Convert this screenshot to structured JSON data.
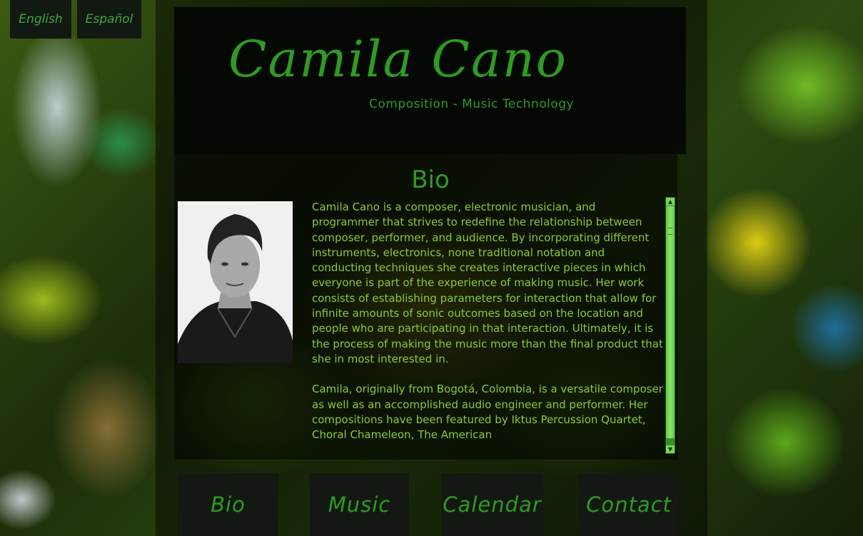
{
  "language": {
    "english": "English",
    "spanish": "Español"
  },
  "header": {
    "title": "Camila Cano",
    "subtitle": "Composition - Music Technology"
  },
  "bio": {
    "heading": "Bio",
    "paragraphs": [
      "Camila Cano is a composer, electronic musician, and programmer that strives to redefine the relationship between composer, performer, and audience. By incorporating different instruments, electronics, none traditional notation and conducting techniques she creates interactive pieces in which everyone is part of the experience of making music. Her work consists of establishing parameters for interaction that allow for infinite amounts of sonic outcomes based on the location and people who are participating in that interaction. Ultimately, it is the process of making the music more than the final product that she in most interested in.",
      "Camila, originally from Bogotá, Colombia, is a versatile composer as well as an accomplished audio engineer and performer. Her compositions have been featured by Iktus Percussion Quartet, Choral Chameleon, The American"
    ]
  },
  "nav": {
    "bio": "Bio",
    "music": "Music",
    "calendar": "Calendar",
    "contact": "Contact"
  },
  "colors": {
    "accent": "#2e9b22",
    "body_text": "#8cc83c",
    "scrollbar": "#5fcc43"
  },
  "icons": {
    "scroll_up": "triangle-up-icon",
    "scroll_down": "triangle-down-icon"
  }
}
